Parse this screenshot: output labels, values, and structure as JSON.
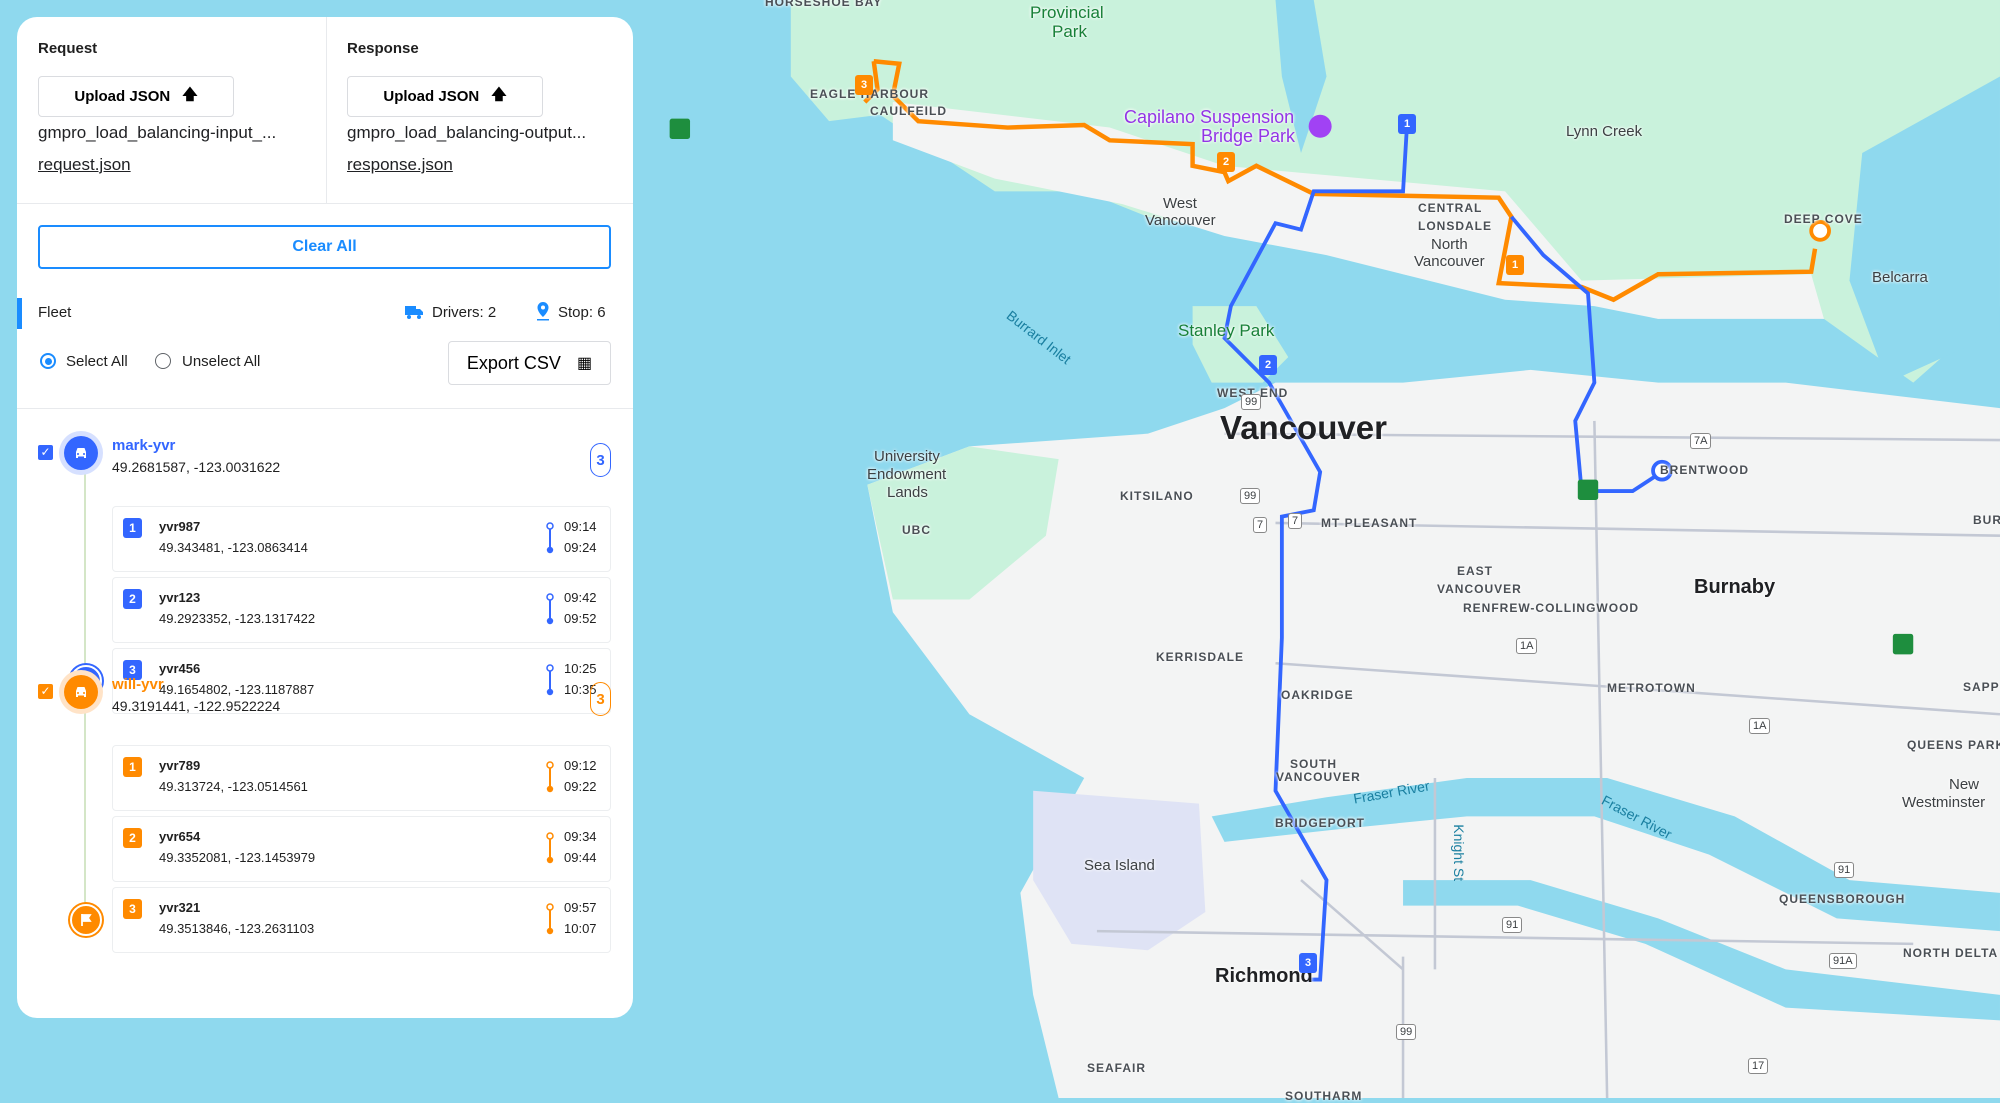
{
  "colors": {
    "accent": "#1a8cff",
    "driver1": "#3366ff",
    "driver2": "#ff8a00",
    "water": "#8fd9ee",
    "park": "#c9f2dc"
  },
  "request": {
    "title": "Request",
    "upload_label": "Upload JSON",
    "upload_icon": "upload-icon",
    "filename": "gmpro_load_balancing-input_...",
    "link": "request.json"
  },
  "response": {
    "title": "Response",
    "upload_label": "Upload JSON",
    "upload_icon": "upload-icon",
    "filename": "gmpro_load_balancing-output...",
    "link": "response.json"
  },
  "clear_all": "Clear All",
  "fleet": {
    "label": "Fleet",
    "drivers": "Drivers: 2",
    "stops": "Stop: 6",
    "select_all": "Select All",
    "unselect_all": "Unselect All",
    "selected": "Select All",
    "export": "Export CSV"
  },
  "vehicles": [
    {
      "name": "mark-yvr",
      "coords": "49.2681587, -123.0031622",
      "count": "3",
      "checked": true,
      "color": "#3366ff",
      "stops": [
        {
          "num": "1",
          "name": "yvr987",
          "coords": "49.343481, -123.0863414",
          "start": "09:14",
          "end": "09:24"
        },
        {
          "num": "2",
          "name": "yvr123",
          "coords": "49.2923352, -123.1317422",
          "start": "09:42",
          "end": "09:52"
        },
        {
          "num": "3",
          "name": "yvr456",
          "coords": "49.1654802, -123.1187887",
          "start": "10:25",
          "end": "10:35"
        }
      ]
    },
    {
      "name": "will-yvr",
      "coords": "49.3191441, -122.9522224",
      "count": "3",
      "checked": true,
      "color": "#ff8a00",
      "stops": [
        {
          "num": "1",
          "name": "yvr789",
          "coords": "49.313724, -123.0514561",
          "start": "09:12",
          "end": "09:22"
        },
        {
          "num": "2",
          "name": "yvr654",
          "coords": "49.3352081, -123.1453979",
          "start": "09:34",
          "end": "09:44"
        },
        {
          "num": "3",
          "name": "yvr321",
          "coords": "49.3513846, -123.2631103",
          "start": "09:57",
          "end": "10:07"
        }
      ]
    }
  ],
  "map": {
    "labels": [
      "HORSESHOE BAY",
      "Provincial",
      "Park",
      "EAGLE HARBOUR",
      "CAULFEILD",
      "Capilano Suspension",
      "Bridge Park",
      "Lynn Creek",
      "West",
      "Vancouver",
      "CENTRAL",
      "LONSDALE",
      "North",
      "Vancouver",
      "DEEP COVE",
      "Belcarra",
      "Burrard Inlet",
      "Stanley Park",
      "WEST END",
      "Vancouver",
      "University",
      "Endowment",
      "Lands",
      "KITSILANO",
      "UBC",
      "MT PLEASANT",
      "BRENTWOOD",
      "EAST",
      "VANCOUVER",
      "RENFREW-COLLINGWOOD",
      "Burnaby",
      "KERRISDALE",
      "OAKRIDGE",
      "METROTOWN",
      "SOUTH",
      "VANCOUVER",
      "Fraser River",
      "BRIDGEPORT",
      "Sea Island",
      "Knight St",
      "Fraser River",
      "QUEENS PARK",
      "New",
      "Westminster",
      "QUEENSBOROUGH",
      "Richmond",
      "NORTH DELTA",
      "SEAFAIR",
      "SOUTHARM",
      "SAPP",
      "BUR"
    ],
    "shields": [
      "99",
      "99",
      "7",
      "7",
      "7A",
      "1A",
      "1A",
      "91",
      "91",
      "91A",
      "99",
      "17"
    ]
  }
}
